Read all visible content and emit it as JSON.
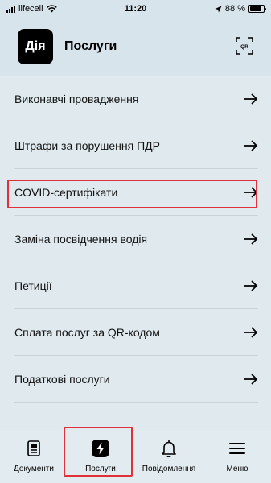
{
  "status_bar": {
    "carrier": "lifecell",
    "time": "11:20",
    "battery_text": "88 %",
    "battery_level": 0.88
  },
  "header": {
    "logo_text": "Дія",
    "title": "Послуги",
    "qr_icon": "qr-code-icon"
  },
  "services": [
    {
      "label": "Виконавчі провадження"
    },
    {
      "label": "Штрафи за порушення ПДР"
    },
    {
      "label": "COVID-сертифікати",
      "highlighted": true
    },
    {
      "label": "Заміна посвідчення водія"
    },
    {
      "label": "Петиції"
    },
    {
      "label": "Сплата послуг за QR-кодом"
    },
    {
      "label": "Податкові послуги"
    }
  ],
  "tabbar": {
    "tabs": [
      {
        "label": "Документи",
        "icon": "document-icon"
      },
      {
        "label": "Послуги",
        "icon": "lightning-icon",
        "active": true
      },
      {
        "label": "Повідомлення",
        "icon": "bell-icon"
      },
      {
        "label": "Меню",
        "icon": "hamburger-icon"
      }
    ]
  },
  "colors": {
    "background": "#dfe9ee",
    "header_background": "#d7e4ec",
    "highlight_red": "#e0303a",
    "logo_black": "#000000"
  }
}
